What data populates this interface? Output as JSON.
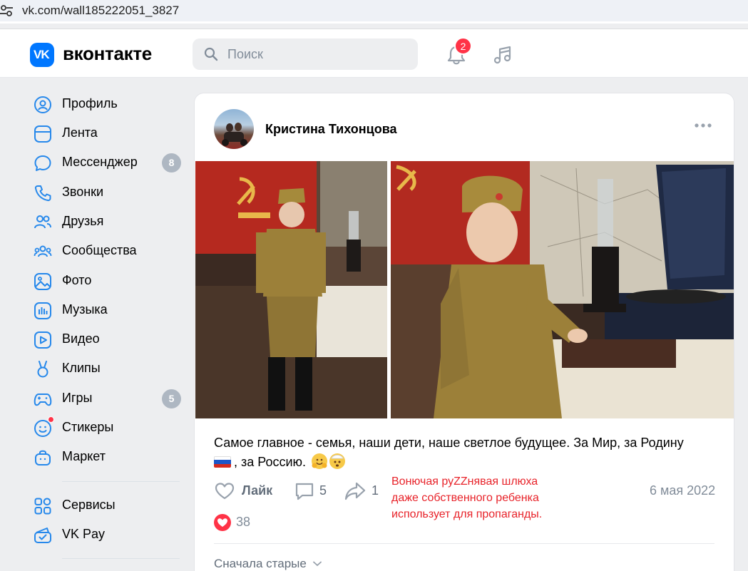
{
  "browser": {
    "url": "vk.com/wall185222051_3827"
  },
  "header": {
    "logo_text": "вконтакте",
    "search_placeholder": "Поиск",
    "notifications_count": "2"
  },
  "sidebar": {
    "items": [
      {
        "label": "Профиль",
        "icon": "profile-icon",
        "badge": ""
      },
      {
        "label": "Лента",
        "icon": "feed-icon",
        "badge": ""
      },
      {
        "label": "Мессенджер",
        "icon": "messenger-icon",
        "badge": "8"
      },
      {
        "label": "Звонки",
        "icon": "phone-icon",
        "badge": ""
      },
      {
        "label": "Друзья",
        "icon": "friends-icon",
        "badge": ""
      },
      {
        "label": "Сообщества",
        "icon": "communities-icon",
        "badge": ""
      },
      {
        "label": "Фото",
        "icon": "photo-icon",
        "badge": ""
      },
      {
        "label": "Музыка",
        "icon": "music-icon",
        "badge": ""
      },
      {
        "label": "Видео",
        "icon": "video-icon",
        "badge": ""
      },
      {
        "label": "Клипы",
        "icon": "clips-icon",
        "badge": ""
      },
      {
        "label": "Игры",
        "icon": "games-icon",
        "badge": "5"
      },
      {
        "label": "Стикеры",
        "icon": "stickers-icon",
        "badge": ""
      },
      {
        "label": "Маркет",
        "icon": "market-icon",
        "badge": ""
      }
    ],
    "extra": [
      {
        "label": "Сервисы",
        "icon": "services-icon"
      },
      {
        "label": "VK Pay",
        "icon": "vkpay-icon"
      }
    ]
  },
  "post": {
    "author": "Кристина Тихонцова",
    "text_part1": "Самое главное - семья, наши дети, наше светлое будущее. За Мир, за Родину",
    "text_part2": ", за Россию.",
    "like_label": "Лайк",
    "comments_count": "5",
    "shares_count": "1",
    "date": "6 мая 2022",
    "likes_count": "38",
    "sort_label": "Сначала старые"
  },
  "annotation": {
    "lines": [
      "Вонючая руZZнявая шлюха",
      "даже собственного ребенка",
      "использует для пропаганды."
    ]
  },
  "colors": {
    "accent": "#0077ff",
    "badge_red": "#ff3347",
    "annotation_red": "#e8232a"
  }
}
